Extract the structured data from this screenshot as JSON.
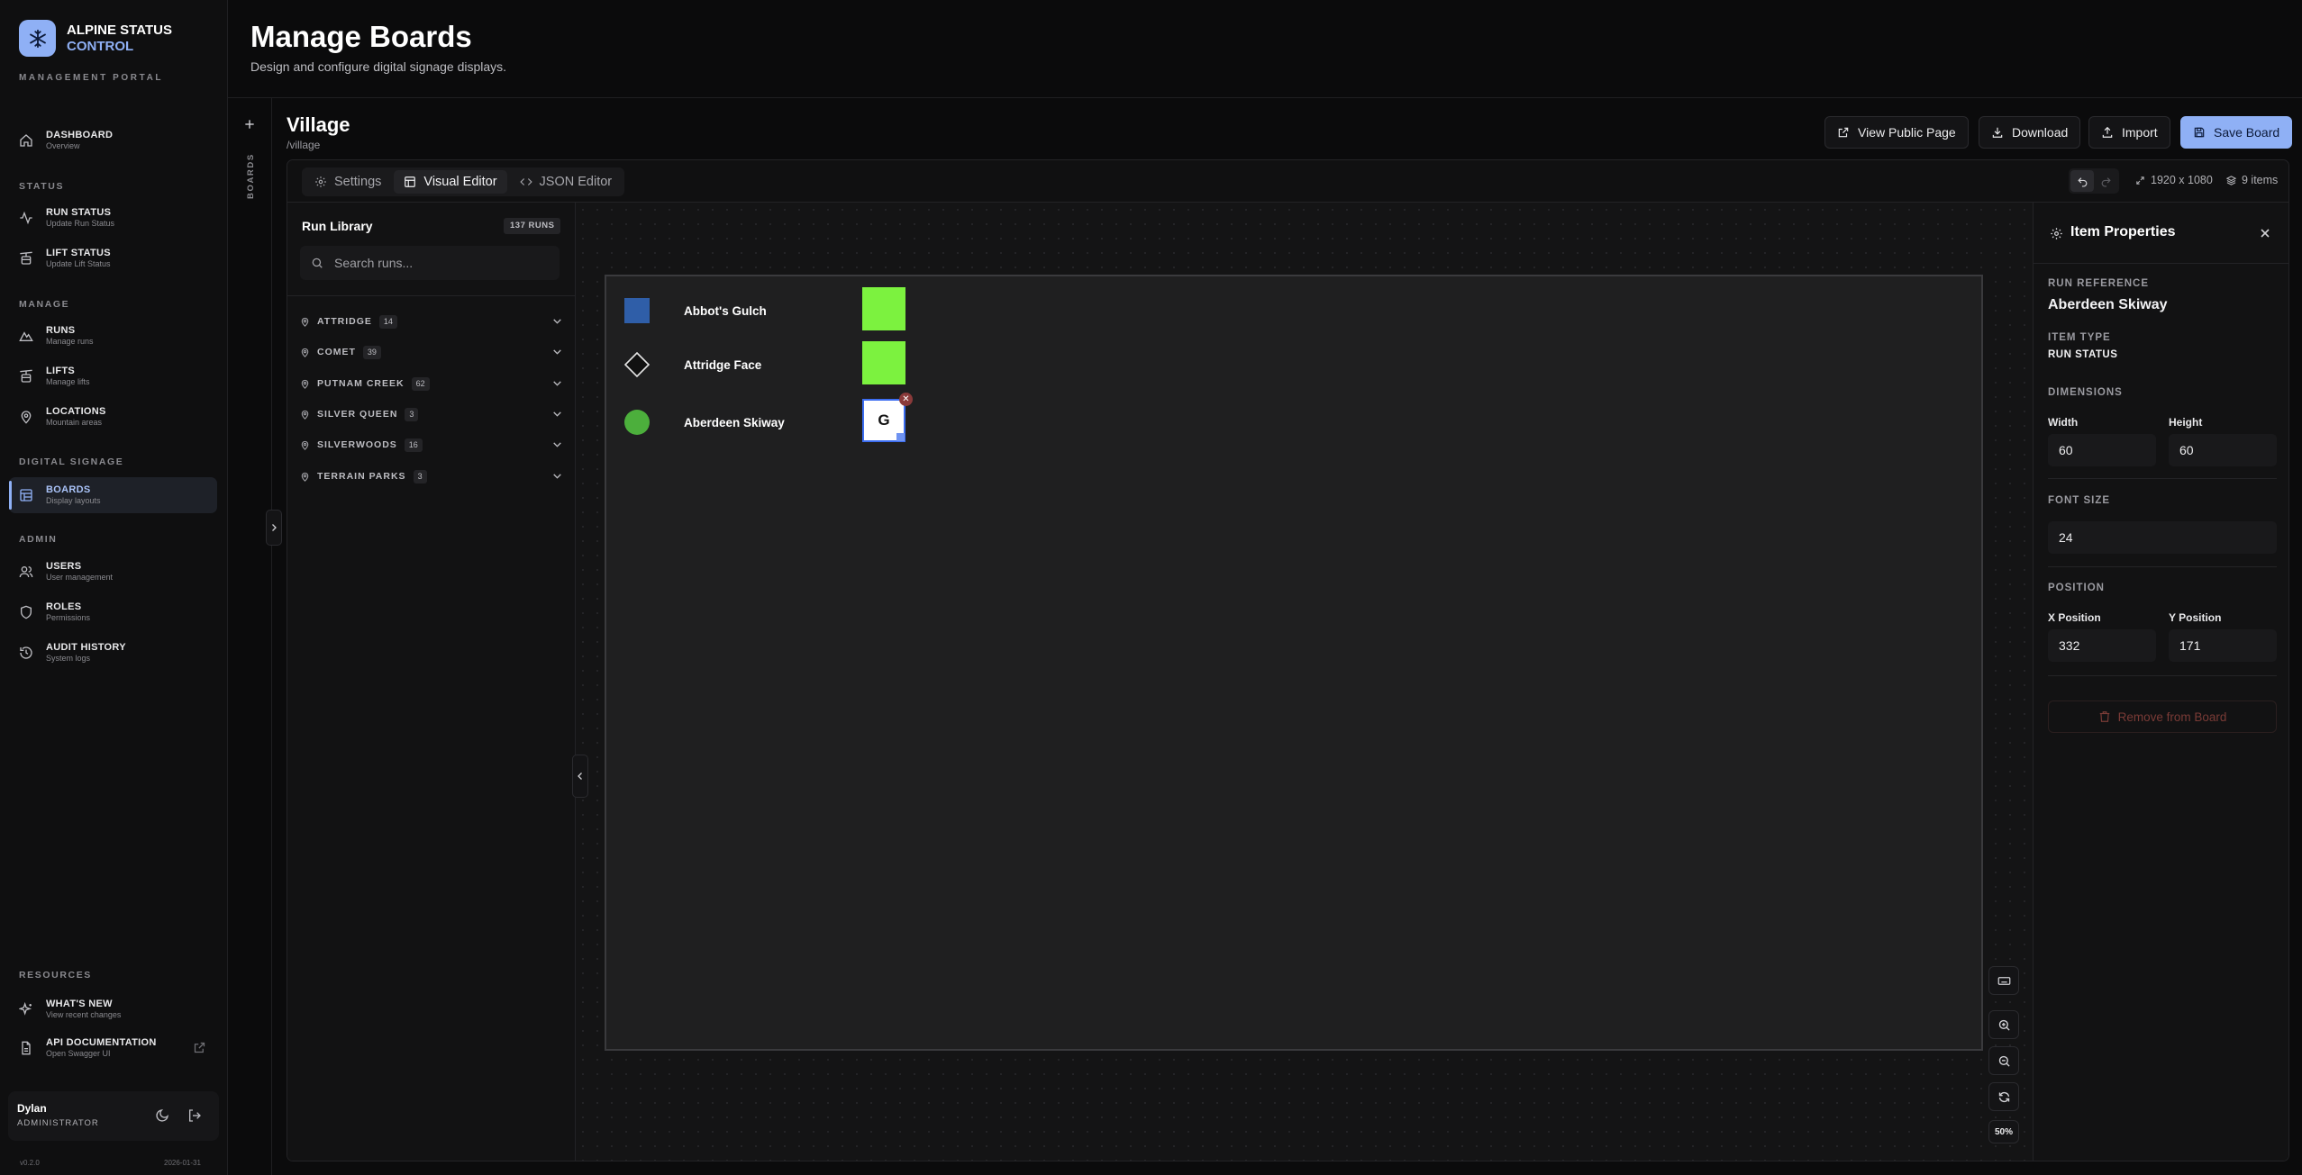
{
  "brand": {
    "line1": "ALPINE STATUS",
    "line2": "CONTROL",
    "subtitle": "MANAGEMENT PORTAL"
  },
  "nav": {
    "dashboard": {
      "label": "DASHBOARD",
      "desc": "Overview"
    },
    "section_status": "STATUS",
    "run_status": {
      "label": "RUN STATUS",
      "desc": "Update Run Status"
    },
    "lift_status": {
      "label": "LIFT STATUS",
      "desc": "Update Lift Status"
    },
    "section_manage": "MANAGE",
    "runs": {
      "label": "RUNS",
      "desc": "Manage runs"
    },
    "lifts": {
      "label": "LIFTS",
      "desc": "Manage lifts"
    },
    "locations": {
      "label": "LOCATIONS",
      "desc": "Mountain areas"
    },
    "section_signage": "DIGITAL SIGNAGE",
    "boards": {
      "label": "BOARDS",
      "desc": "Display layouts"
    },
    "section_admin": "ADMIN",
    "users": {
      "label": "USERS",
      "desc": "User management"
    },
    "roles": {
      "label": "ROLES",
      "desc": "Permissions"
    },
    "audit": {
      "label": "AUDIT HISTORY",
      "desc": "System logs"
    },
    "section_resources": "RESOURCES",
    "whats_new": {
      "label": "WHAT'S NEW",
      "desc": "View recent changes"
    },
    "api_docs": {
      "label": "API DOCUMENTATION",
      "desc": "Open Swagger UI"
    }
  },
  "user": {
    "name": "Dylan",
    "role": "ADMINISTRATOR"
  },
  "footer": {
    "version": "v0.2.0",
    "date": "2026-01-31"
  },
  "header": {
    "title": "Manage Boards",
    "subtitle": "Design and configure digital signage displays."
  },
  "rail": {
    "label": "BOARDS"
  },
  "board": {
    "name": "Village",
    "slug": "/village"
  },
  "actions": {
    "view_public": "View Public Page",
    "download": "Download",
    "import": "Import",
    "save": "Save Board"
  },
  "tabs": {
    "settings": "Settings",
    "visual": "Visual Editor",
    "json": "JSON Editor"
  },
  "toolbar": {
    "dimensions": "1920 x 1080",
    "items": "9 items"
  },
  "library": {
    "title": "Run Library",
    "count": "137 RUNS",
    "search_placeholder": "Search runs...",
    "groups": [
      {
        "name": "ATTRIDGE",
        "count": "14"
      },
      {
        "name": "COMET",
        "count": "39"
      },
      {
        "name": "PUTNAM CREEK",
        "count": "62"
      },
      {
        "name": "SILVER QUEEN",
        "count": "3"
      },
      {
        "name": "SILVERWOODS",
        "count": "16"
      },
      {
        "name": "TERRAIN PARKS",
        "count": "3"
      }
    ]
  },
  "canvas_items": [
    {
      "label": "Abbot's Gulch",
      "difficulty": "blue-square",
      "status_color": "#7cf23f"
    },
    {
      "label": "Attridge Face",
      "difficulty": "black-diamond",
      "status_color": "#7cf23f"
    },
    {
      "label": "Aberdeen Skiway",
      "difficulty": "green-circle",
      "status_letter": "G"
    }
  ],
  "zoom": {
    "level": "50%"
  },
  "props": {
    "title": "Item Properties",
    "run_ref_label": "RUN REFERENCE",
    "run_ref": "Aberdeen Skiway",
    "item_type_label": "ITEM TYPE",
    "item_type": "RUN STATUS",
    "dimensions_label": "DIMENSIONS",
    "width_label": "Width",
    "width": "60",
    "height_label": "Height",
    "height": "60",
    "font_size_label": "FONT SIZE",
    "font_size": "24",
    "position_label": "POSITION",
    "x_label": "X Position",
    "x": "332",
    "y_label": "Y Position",
    "y": "171",
    "remove": "Remove from Board"
  },
  "colors": {
    "accent": "#8fb0f5",
    "status_open": "#7cf23f",
    "blue_square": "#2f5ea8",
    "green_circle": "#4caf3c"
  }
}
